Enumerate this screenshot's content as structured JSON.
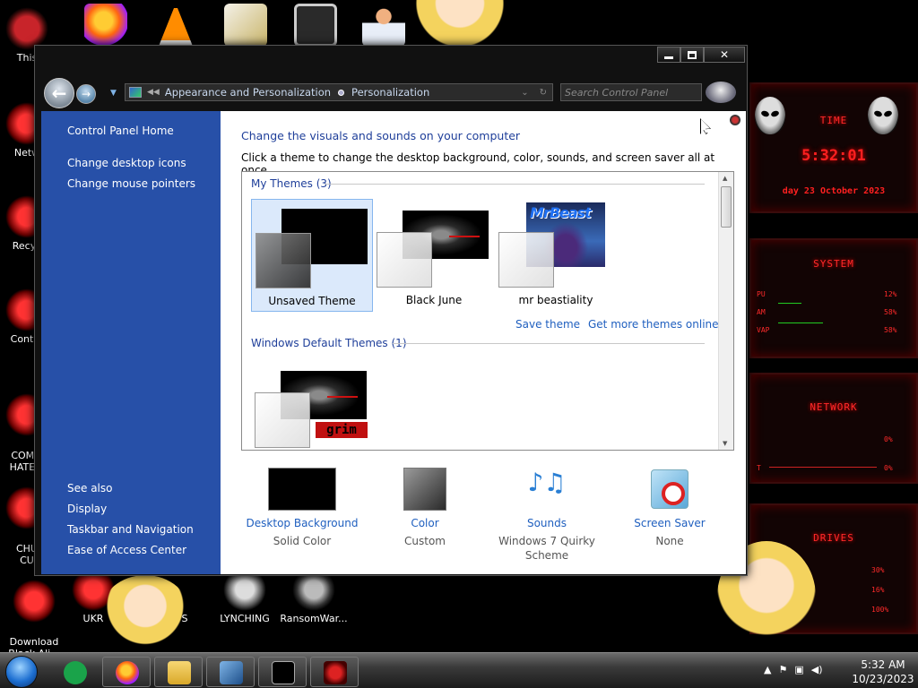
{
  "desktop": {
    "icons_left": [
      {
        "label": "This",
        "name": "desktop-icon-this-pc"
      },
      {
        "label": "Netw",
        "name": "desktop-icon-network"
      },
      {
        "label": "Recyc",
        "name": "desktop-icon-recycle-bin"
      },
      {
        "label": "Contro",
        "name": "desktop-icon-control-panel"
      },
      {
        "label": "COMM\nHATE T",
        "name": "desktop-icon-comm"
      },
      {
        "label": "CHU\nCU",
        "name": "desktop-icon-chu"
      },
      {
        "label": "Download\nBlack Ali...",
        "name": "desktop-icon-download-black-alien"
      }
    ],
    "icons_bottom": [
      {
        "label": "UKR",
        "name": "desktop-icon-ukr"
      },
      {
        "label": "S",
        "name": "desktop-icon-s"
      },
      {
        "label": "LYNCHING",
        "name": "desktop-icon-lynching"
      },
      {
        "label": "RansomWar...",
        "name": "desktop-icon-ransomware"
      }
    ]
  },
  "widgets": {
    "time_title": "TIME",
    "clock": "5:32:01",
    "date_line": "day 23 October 2023",
    "system_title": "SYSTEM",
    "system_rows": [
      {
        "label": "PU",
        "value": "12%"
      },
      {
        "label": "AM",
        "value": "58%"
      },
      {
        "label": "VAP",
        "value": "58%"
      }
    ],
    "network_title": "NETWORK",
    "network_rows": [
      {
        "label": "",
        "value": "0%"
      },
      {
        "label": "T",
        "value": "0%"
      }
    ],
    "drives_title": "DRIVES",
    "drives_rows": [
      {
        "label": "",
        "value": "30%"
      },
      {
        "label": "",
        "value": "16%"
      },
      {
        "label": "",
        "value": "100%"
      }
    ]
  },
  "window": {
    "address": {
      "crumb1": "Appearance and Personalization",
      "crumb2": "Personalization"
    },
    "search_placeholder": "Search Control Panel",
    "sidebar": {
      "home": "Control Panel Home",
      "links": [
        "Change desktop icons",
        "Change mouse pointers"
      ],
      "see_also_title": "See also",
      "see_also": [
        "Display",
        "Taskbar and Navigation",
        "Ease of Access Center"
      ]
    },
    "content": {
      "heading": "Change the visuals and sounds on your computer",
      "subheading": "Click a theme to change the desktop background, color, sounds, and screen saver all at once.",
      "my_themes_title": "My Themes (3)",
      "my_themes": [
        "Unsaved Theme",
        "Black June",
        "mr beastiality"
      ],
      "beast_thumb_text": "MrBeast",
      "save_theme": "Save theme",
      "get_more": "Get more themes online",
      "default_themes_title": "Windows Default Themes (1)",
      "grim_text": "grim"
    },
    "bottom": [
      {
        "label": "Desktop Background",
        "value": "Solid Color"
      },
      {
        "label": "Color",
        "value": "Custom"
      },
      {
        "label": "Sounds",
        "value": "Windows 7 Quirky Scheme"
      },
      {
        "label": "Screen Saver",
        "value": "None"
      }
    ]
  },
  "taskbar": {
    "time": "5:32 AM",
    "date": "10/23/2023"
  },
  "colors": {
    "sidebar_blue": "#2750a8",
    "link_blue": "#1f5fbf",
    "heading_blue": "#1f3f9a",
    "widget_red": "#ff2020"
  }
}
